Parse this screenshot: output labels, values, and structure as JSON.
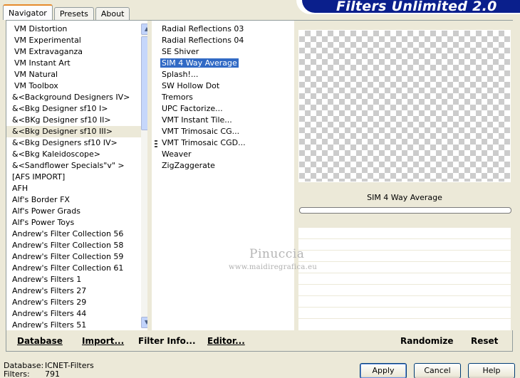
{
  "tabs": [
    {
      "label": "Navigator"
    },
    {
      "label": "Presets"
    },
    {
      "label": "About"
    }
  ],
  "banner": {
    "title": "Filters Unlimited 2.0"
  },
  "categories": [
    "VM Distortion",
    "VM Experimental",
    "VM Extravaganza",
    "VM Instant Art",
    "VM Natural",
    "VM Toolbox",
    "&<Background Designers IV>",
    "&<Bkg Designer sf10 I>",
    "&<BKg Designer sf10 II>",
    "&<Bkg Designer sf10 III>",
    "&<Bkg Designers sf10 IV>",
    "&<Bkg Kaleidoscope>",
    "&<Sandflower Specials\"v\" >",
    "[AFS IMPORT]",
    "AFH",
    "Alf's Border FX",
    "Alf's Power Grads",
    "Alf's Power Toys",
    "Andrew's Filter Collection 56",
    "Andrew's Filter Collection 58",
    "Andrew's Filter Collection 59",
    "Andrew's Filter Collection 61",
    "Andrew's Filters 1",
    "Andrew's Filters 27",
    "Andrew's Filters 29",
    "Andrew's Filters 44",
    "Andrew's Filters 51"
  ],
  "selected_category": "&<Bkg Designer sf10 III>",
  "filters": [
    "Radial Reflections 03",
    "Radial Reflections 04",
    "SE Shiver",
    "SIM 4 Way Average",
    "Splash!...",
    "SW Hollow Dot",
    "Tremors",
    "UPC Factorize...",
    "VMT Instant Tile...",
    "VMT Trimosaic CG...",
    "VMT Trimosaic CGD...",
    "Weaver",
    "ZigZaggerate"
  ],
  "selected_filter": "SIM 4 Way Average",
  "preview": {
    "filter_name": "SIM 4 Way Average"
  },
  "bottom_buttons": {
    "database": "Database",
    "import": "Import...",
    "filter_info": "Filter Info...",
    "editor": "Editor...",
    "randomize": "Randomize",
    "reset": "Reset"
  },
  "status": {
    "database_label": "Database:",
    "database_value": "ICNET-Filters",
    "filters_label": "Filters:",
    "filters_value": "791"
  },
  "dialog_buttons": {
    "apply": "Apply",
    "cancel": "Cancel",
    "help": "Help"
  },
  "watermark": {
    "name": "Pinuccia",
    "url": "www.maidiregrafica.eu"
  }
}
